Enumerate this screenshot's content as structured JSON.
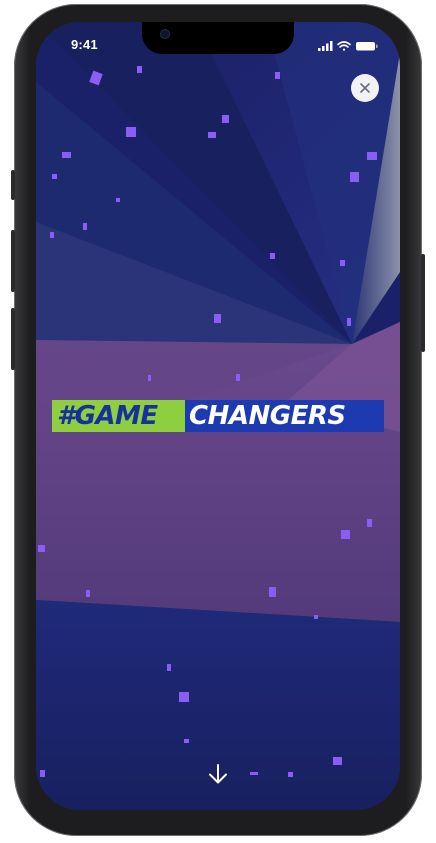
{
  "status_bar": {
    "time": "9:41",
    "icons": [
      "signal-icon",
      "wifi-icon",
      "battery-icon"
    ]
  },
  "close_button": {
    "icon": "close-icon",
    "symbol": "×"
  },
  "hero": {
    "hashtag_part1": "#GAME",
    "hashtag_part2": "CHANGERS",
    "accent_green": "#8dcf3f",
    "accent_blue": "#1e3ab0"
  },
  "scroll_hint": {
    "icon": "arrow-down-icon"
  },
  "colors": {
    "background_navy": "#1b2169",
    "background_purple": "#5b3b7e",
    "confetti": "#8b5cf6"
  }
}
